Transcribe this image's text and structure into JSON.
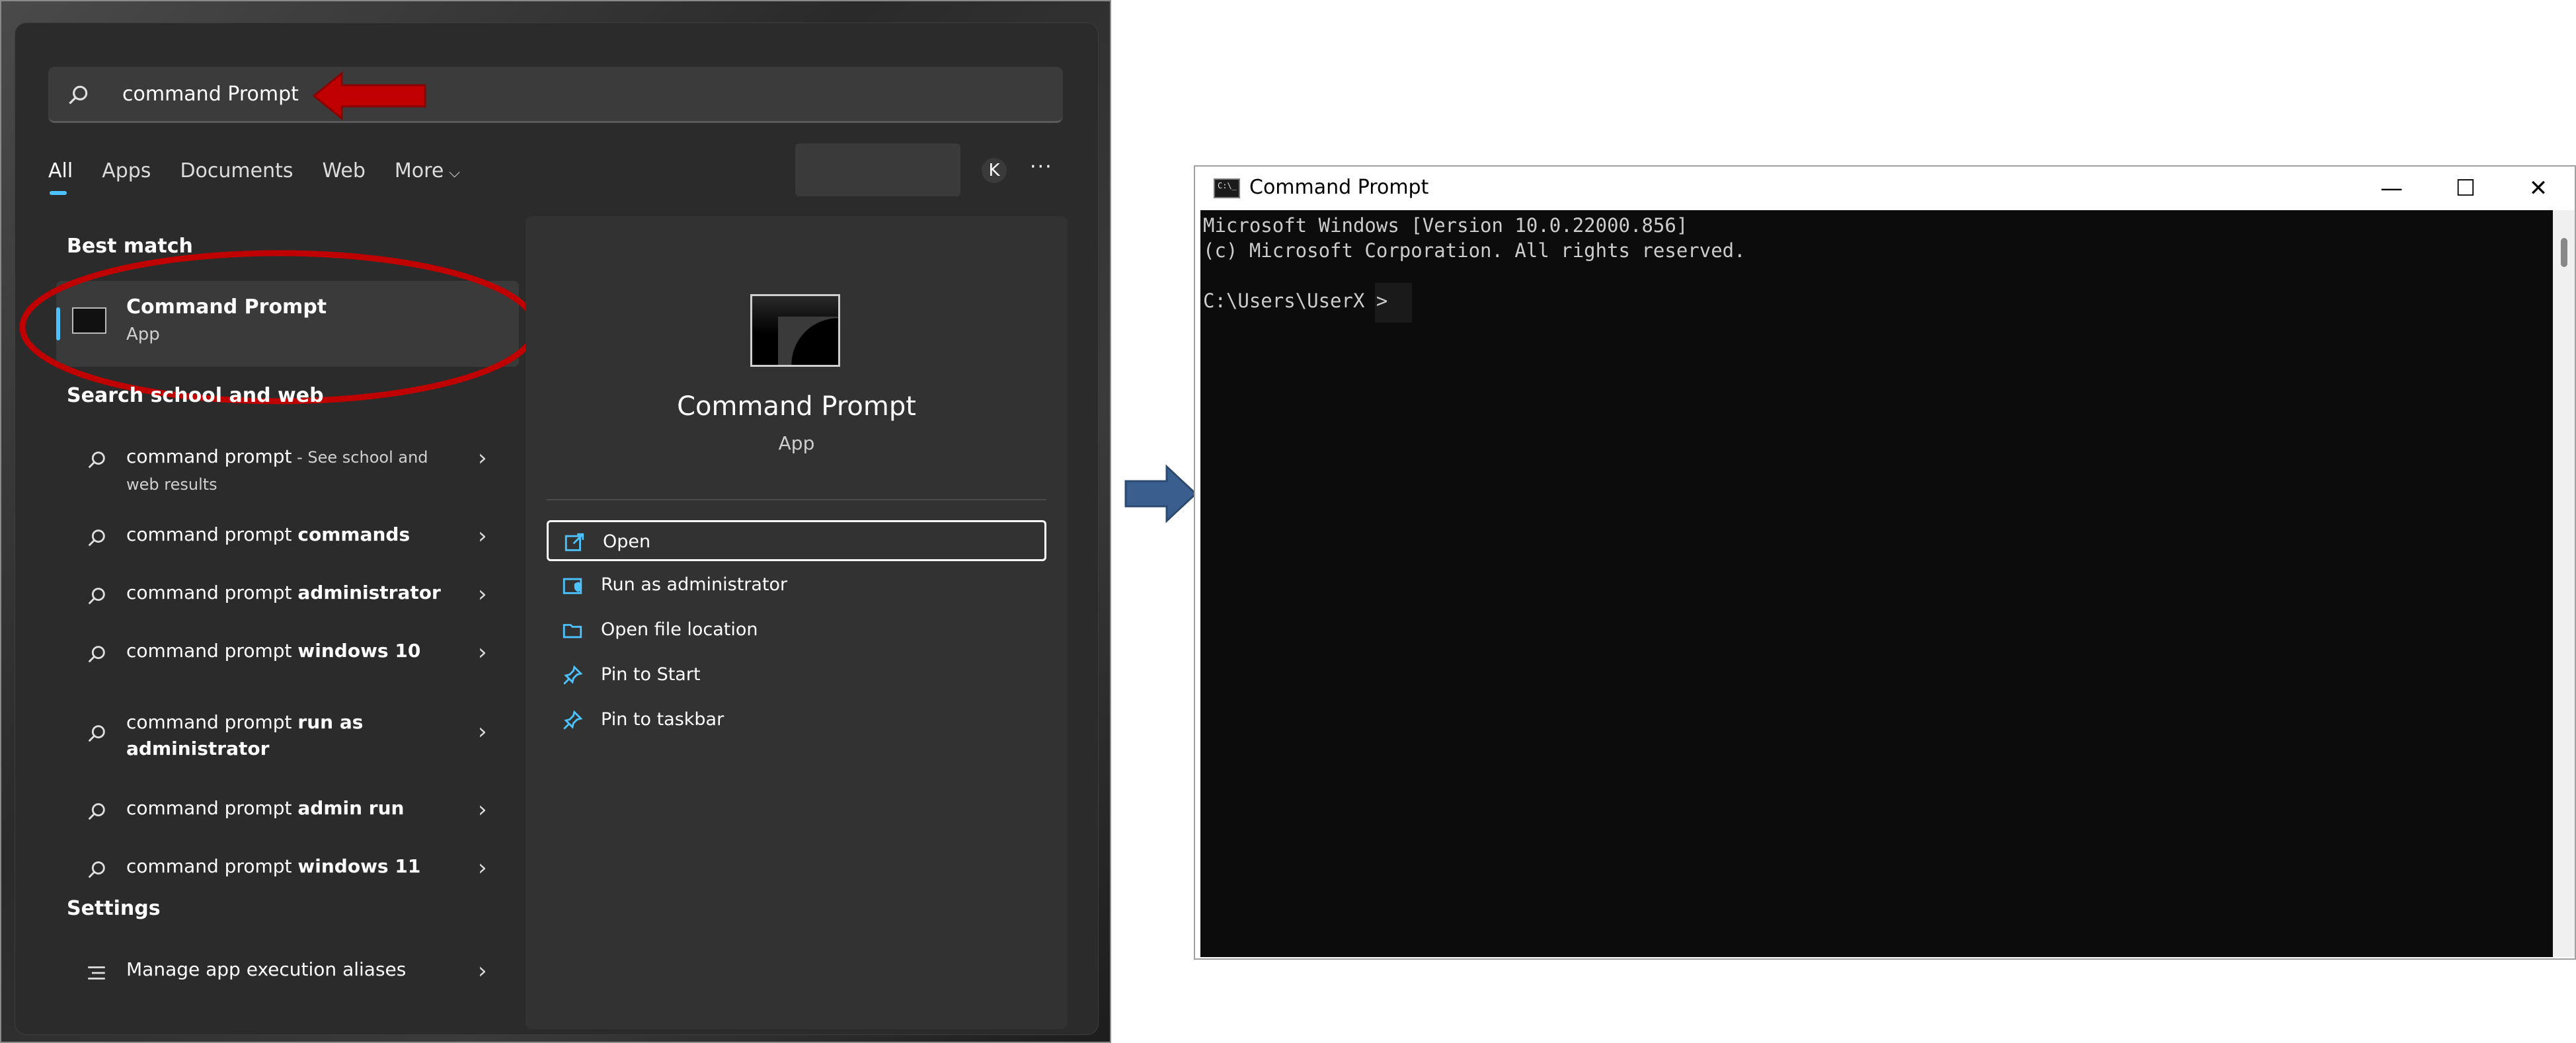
{
  "search": {
    "query": "command Prompt",
    "tabs": [
      "All",
      "Apps",
      "Documents",
      "Web",
      "More"
    ],
    "account_initial": "K",
    "more_options": "···"
  },
  "best_match": {
    "title": "Best match",
    "name": "Command Prompt",
    "type": "App"
  },
  "web_section": {
    "title": "Search school and web",
    "rows": [
      {
        "prefix": "command prompt",
        "bold": "",
        "suffix": " - See school and web results"
      },
      {
        "prefix": "command prompt ",
        "bold": "commands",
        "suffix": ""
      },
      {
        "prefix": "command prompt ",
        "bold": "administrator",
        "suffix": ""
      },
      {
        "prefix": "command prompt ",
        "bold": "windows 10",
        "suffix": ""
      },
      {
        "prefix": "command prompt ",
        "bold": "run as administrator",
        "suffix": ""
      },
      {
        "prefix": "command prompt ",
        "bold": "admin run",
        "suffix": ""
      },
      {
        "prefix": "command prompt ",
        "bold": "windows 11",
        "suffix": ""
      }
    ]
  },
  "settings_section": {
    "title": "Settings",
    "item": "Manage app execution aliases"
  },
  "details_pane": {
    "name": "Command Prompt",
    "type": "App",
    "actions": [
      "Open",
      "Run as administrator",
      "Open file location",
      "Pin to Start",
      "Pin to taskbar"
    ]
  },
  "cmd_window": {
    "title": "Command Prompt",
    "lines": [
      "Microsoft Windows [Version 10.0.22000.856]",
      "(c) Microsoft Corporation. All rights reserved."
    ],
    "prompt": "C:\\Users\\UserX >"
  },
  "colors": {
    "accent": "#4cc2ff",
    "highlight_red": "#c00000",
    "arrow_blue": "#3a5f8f"
  }
}
